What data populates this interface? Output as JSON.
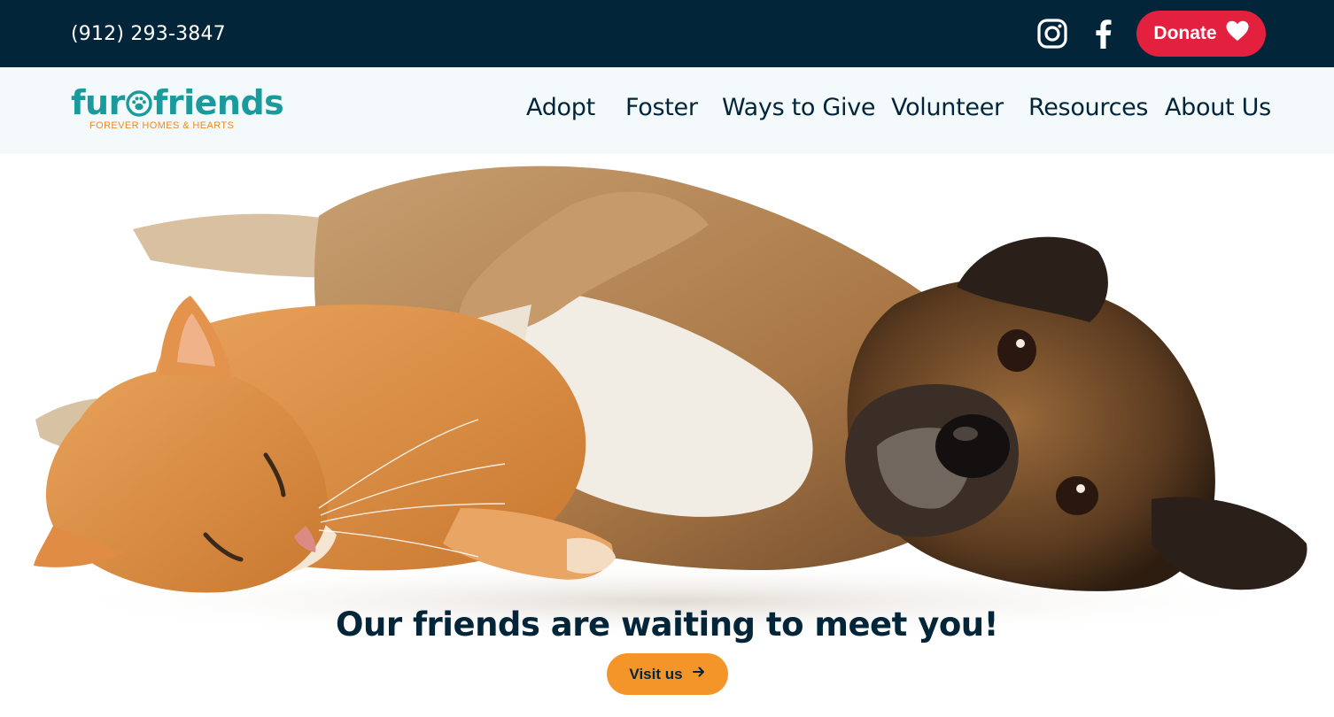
{
  "topbar": {
    "phone": "(912) 293-3847",
    "social": [
      "instagram-icon",
      "facebook-icon"
    ],
    "donate_label": "Donate",
    "donate_icon": "heart-icon",
    "colors": {
      "background": "#03253a",
      "donate": "#e4203f"
    }
  },
  "logo": {
    "word_left": "fur",
    "word_right": "friends",
    "tagline": "FOREVER HOMES & HEARTS",
    "icon": "paw-icon",
    "colors": {
      "word": "#1a9a9c",
      "tagline": "#f08a1d"
    }
  },
  "nav": {
    "items": [
      "Adopt",
      "Foster",
      "Ways to Give",
      "Volunteer",
      "Resources",
      "About Us"
    ]
  },
  "hero": {
    "title": "Our friends are waiting to meet you!",
    "cta_label": "Visit us",
    "cta_icon": "arrow-right-icon",
    "colors": {
      "cta": "#f4952a",
      "title": "#03253a"
    }
  }
}
